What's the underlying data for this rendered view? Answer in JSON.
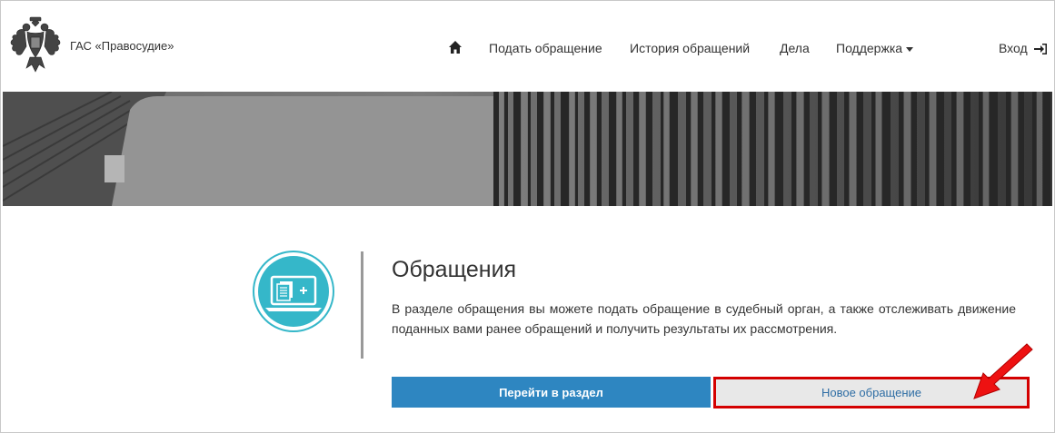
{
  "header": {
    "brand_name": "ГАС «Правосудие»",
    "nav": {
      "submit": "Подать обращение",
      "history": "История обращений",
      "cases": "Дела",
      "support": "Поддержка",
      "login": "Вход"
    }
  },
  "section": {
    "title": "Обращения",
    "description": "В разделе обращения вы можете подать обращение в судебный орган, а также отслеживать движение поданных вами ранее обращений и получить результаты их рассмотрения.",
    "go_button": "Перейти в раздел",
    "new_button": "Новое обращение"
  },
  "colors": {
    "primary_button": "#2e86c1",
    "icon_teal": "#35b7c9",
    "highlight_red": "#d40000",
    "link_blue": "#2e6da4"
  },
  "icons": {
    "emblem": "coat-of-arms-icon",
    "home": "home-icon",
    "login": "sign-in-icon",
    "section": "laptop-document-icon",
    "annotation": "red-arrow-icon"
  }
}
